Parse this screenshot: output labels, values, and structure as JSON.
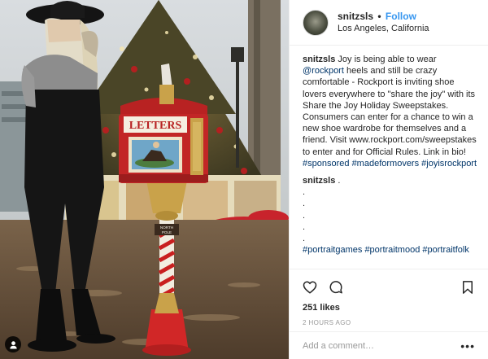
{
  "post": {
    "author": "snitzsls",
    "separator": "•",
    "follow_label": "Follow",
    "location": "Los Angeles, California",
    "image_signs": {
      "mailbox_sign": "LETTERS",
      "pole_sign_line1": "NORTH",
      "pole_sign_line2": "POLE"
    }
  },
  "caption": {
    "username": "snitzsls",
    "text_1": "Joy is being able to wear",
    "mention": "@rockport",
    "text_2": "heels and still be crazy comfortable - Rockport is inviting shoe lovers everywhere to \"share the joy\" with its Share the Joy Holiday Sweepstakes. Consumers can enter for a chance to win a new shoe wardrobe for themselves and a friend. Visit www.rockport.com/sweepstakes to enter and for Official Rules. Link in bio!",
    "tag_1": "#sponsored",
    "tag_2": "#madeformovers",
    "tag_3": "#joyisrockport"
  },
  "comment": {
    "username": "snitzsls",
    "first_text": ".",
    "dot_lines": [
      ".",
      ".",
      ".",
      ".",
      "."
    ],
    "tag_1": "#portraitgames",
    "tag_2": "#portraitmood",
    "tag_3": "#portraitfolk"
  },
  "actions": {
    "like_icon": "heart-icon",
    "comment_icon": "speech-bubble-icon",
    "save_icon": "bookmark-icon",
    "likes_text": "251 likes",
    "time_ago": "2 HOURS AGO"
  },
  "add_comment": {
    "placeholder": "Add a comment…",
    "more_label": "•••"
  },
  "colors": {
    "link": "#003569",
    "follow": "#3897f0",
    "timestamp": "#999999",
    "text": "#262626"
  }
}
